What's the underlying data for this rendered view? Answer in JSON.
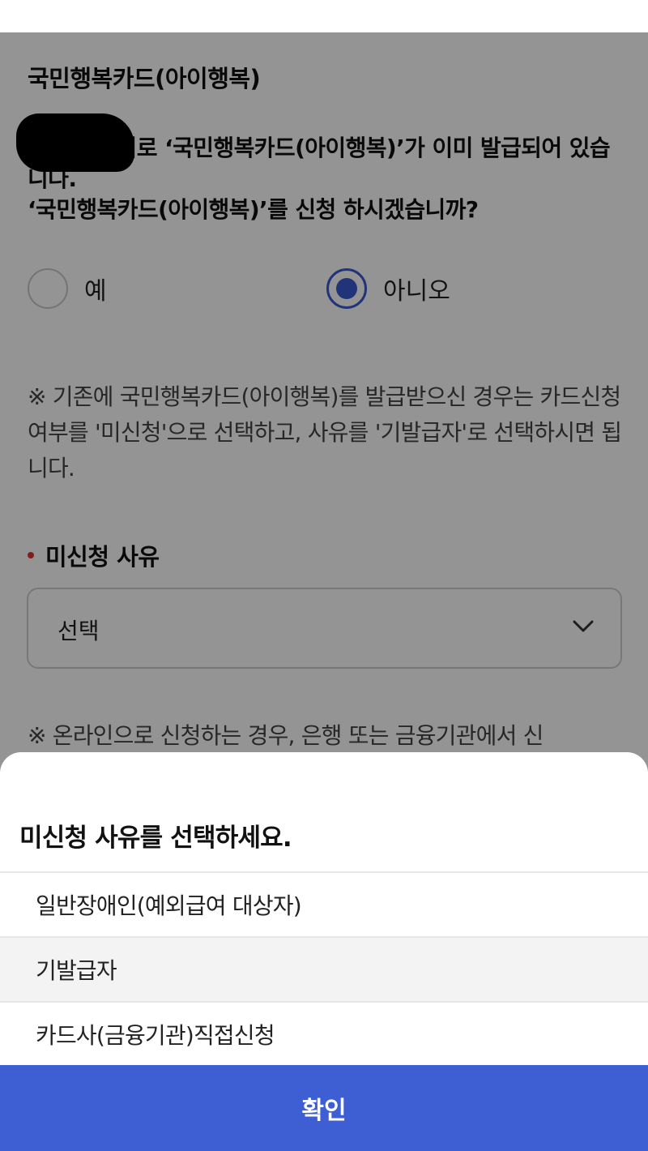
{
  "page": {
    "section_title": "국민행복카드(아이행복)",
    "question_line1": "　　　　의로 ‘국민행복카드(아이행복)’가 이미 발급되어 있습니다.",
    "question_line2": "‘국민행복카드(아이행복)’를 신청 하시겠습니까?",
    "radio": {
      "yes_label": "예",
      "no_label": "아니오",
      "selected": "아니오"
    },
    "notice1": "※ 기존에 국민행복카드(아이행복)를 발급받으신 경우는 카드신청여부를 '미신청'으로 선택하고, 사유를 '기발급자'로 선택하시면 됩니다.",
    "reason_label": "미신청 사유",
    "reason_select_value": "선택",
    "notice2": "※ 온라인으로 신청하는 경우, 은행 또는 금융기관에서 신"
  },
  "sheet": {
    "title": "미신청 사유를 선택하세요.",
    "options": [
      "일반장애인(예외급여 대상자)",
      "기발급자",
      "카드사(금융기관)직접신청"
    ],
    "highlighted_option": "기발급자",
    "confirm_label": "확인"
  },
  "colors": {
    "accent": "#3d5fd3",
    "required_dot": "#dd3333",
    "overlay": "rgba(0,0,0,0.42)"
  },
  "icons": {
    "select_arrow": "chevron-down-icon"
  }
}
